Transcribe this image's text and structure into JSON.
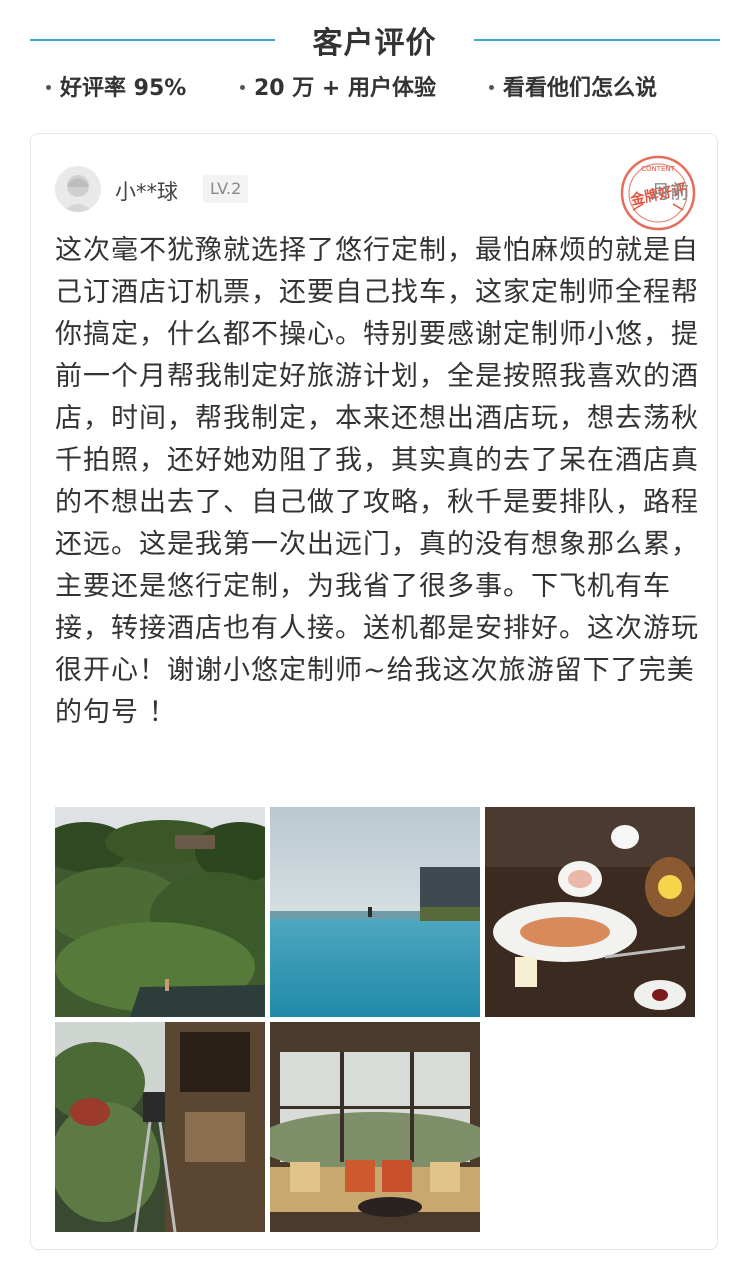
{
  "header": {
    "title": "客户评价"
  },
  "stats": [
    "好评率 95%",
    "20 万 + 用户体验",
    "看看他们怎么说"
  ],
  "review": {
    "user_name": "小**球",
    "level": "LV.2",
    "time": "月前",
    "seal_text": "金牌好评",
    "seal_small_text": "CONTENT",
    "text": "这次毫不犹豫就选择了悠行定制，最怕麻烦的就是自己订酒店订机票，还要自己找车，这家定制师全程帮你搞定，什么都不操心。特别要感谢定制师小悠，提前一个月帮我制定好旅游计划，全是按照我喜欢的酒店，时间，帮我制定，本来还想出酒店玩，想去荡秋千拍照，还好她劝阻了我，其实真的去了呆在酒店真的不想出去了、自己做了攻略，秋千是要排队，路程还远。这是我第一次出远门，真的没有想象那么累，主要还是悠行定制，为我省了很多事。下飞机有车接，转接酒店也有人接。送机都是安排好。这次游玩很开心！谢谢小悠定制师~给我这次旅游留下了完美的句号 ！"
  },
  "photos": [
    "jungle-swing-photo",
    "infinity-pool-photo",
    "breakfast-table-photo",
    "garden-funicular-photo",
    "window-lounge-photo"
  ]
}
